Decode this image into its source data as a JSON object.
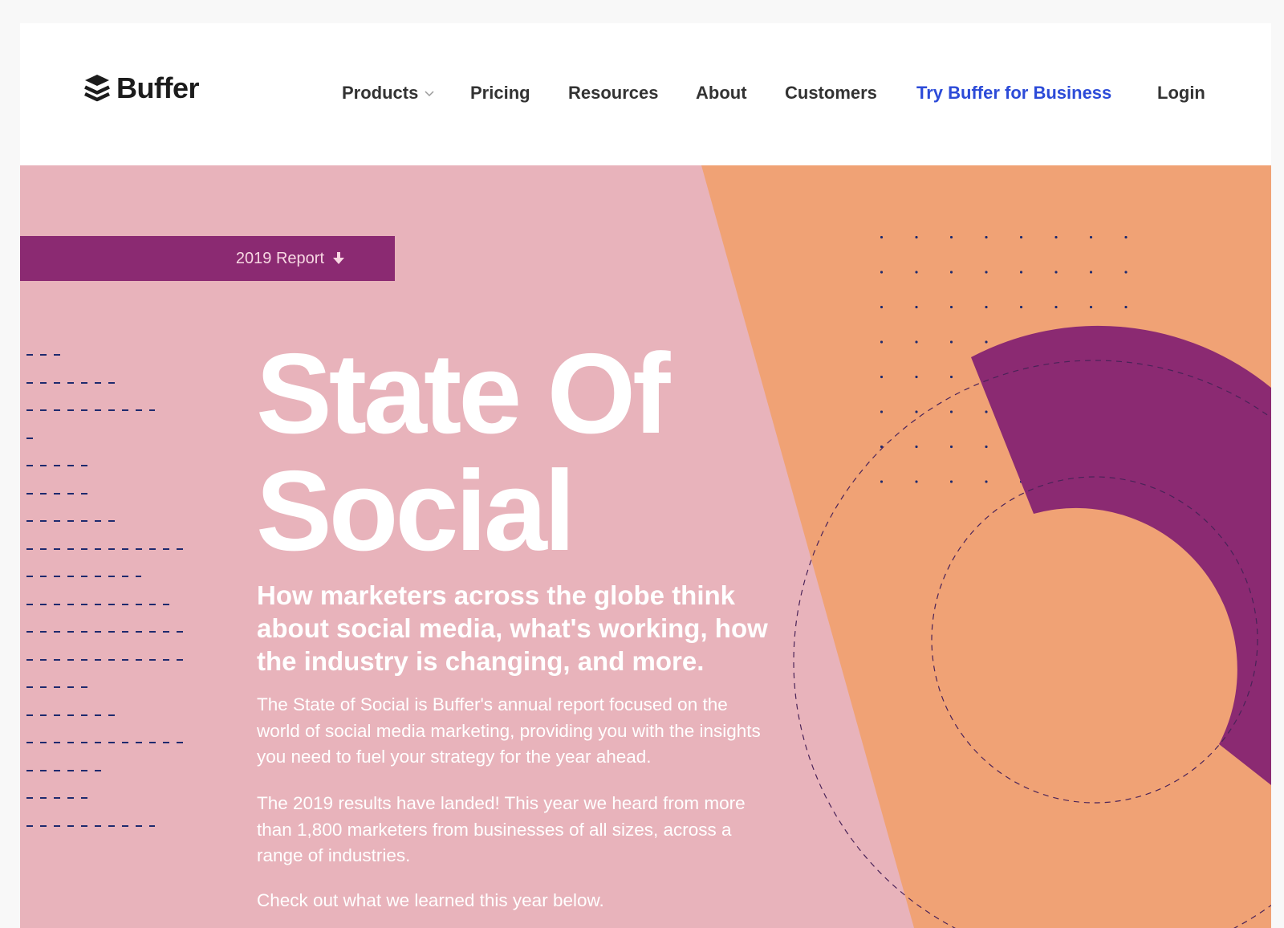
{
  "header": {
    "logo_text": "Buffer",
    "nav": {
      "products": "Products",
      "pricing": "Pricing",
      "resources": "Resources",
      "about": "About",
      "customers": "Customers",
      "try_business": "Try Buffer for Business",
      "login": "Login"
    }
  },
  "hero": {
    "report_button": "2019 Report",
    "title_line1": "State Of",
    "title_line2": "Social",
    "subtitle": "How marketers across the globe think about social media, what's working, how the industry is changing, and more.",
    "paragraph1": "The State of Social is Buffer's annual report focused on the world of social media marketing, providing you with the insights you need to fuel your strategy for the year ahead.",
    "paragraph2": "The 2019 results have landed! This year we heard from more than 1,800 marketers from businesses of all sizes, across a range of industries.",
    "paragraph3": "Check out what we learned this year below."
  },
  "colors": {
    "pink": "#e8b3bb",
    "orange": "#f0a275",
    "purple": "#8b2a72",
    "navy": "#1e2a6e",
    "accent_link": "#2c4bd8"
  },
  "icons": [
    "buffer-logo-icon",
    "chevron-down-icon",
    "arrow-down-icon"
  ]
}
